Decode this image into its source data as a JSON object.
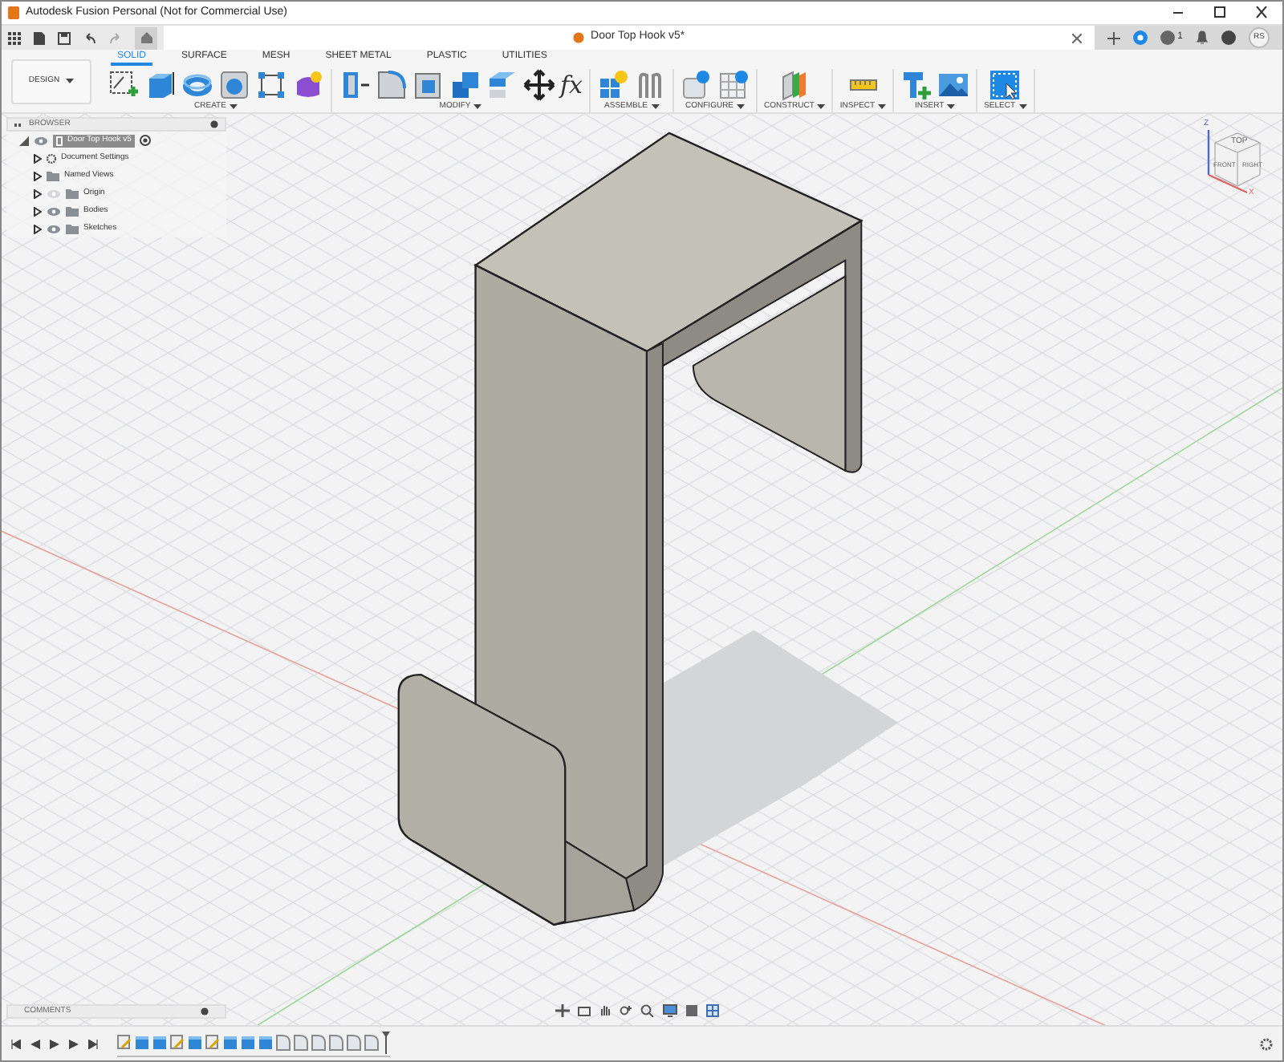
{
  "window": {
    "title": "Autodesk Fusion Personal (Not for Commercial Use)"
  },
  "document_tab": {
    "title": "Door Top Hook v5*"
  },
  "account": {
    "job_count": "1",
    "initials": "RS"
  },
  "workspace": {
    "label": "DESIGN"
  },
  "toolbar_tabs": [
    {
      "label": "SOLID",
      "selected": true
    },
    {
      "label": "SURFACE",
      "selected": false
    },
    {
      "label": "MESH",
      "selected": false
    },
    {
      "label": "SHEET METAL",
      "selected": false
    },
    {
      "label": "PLASTIC",
      "selected": false
    },
    {
      "label": "UTILITIES",
      "selected": false
    }
  ],
  "toolbar_groups": [
    {
      "label": "CREATE",
      "tools": [
        {
          "kind": "sketch"
        },
        {
          "kind": "extrude"
        },
        {
          "kind": "revolve"
        },
        {
          "kind": "hole"
        },
        {
          "kind": "pattern"
        },
        {
          "kind": "form"
        }
      ]
    },
    {
      "label": "MODIFY",
      "tools": [
        {
          "kind": "presspull"
        },
        {
          "kind": "fillet"
        },
        {
          "kind": "shell"
        },
        {
          "kind": "combine"
        },
        {
          "kind": "split"
        },
        {
          "kind": "move"
        },
        {
          "kind": "function",
          "glyph": "fx"
        }
      ]
    },
    {
      "label": "ASSEMBLE",
      "tools": [
        {
          "kind": "component"
        },
        {
          "kind": "joint"
        }
      ]
    },
    {
      "label": "CONFIGURE",
      "tools": [
        {
          "kind": "configure"
        },
        {
          "kind": "table"
        }
      ]
    },
    {
      "label": "CONSTRUCT",
      "tools": [
        {
          "kind": "plane"
        }
      ]
    },
    {
      "label": "INSPECT",
      "tools": [
        {
          "kind": "measure"
        }
      ]
    },
    {
      "label": "INSERT",
      "tools": [
        {
          "kind": "derive"
        },
        {
          "kind": "image"
        }
      ]
    },
    {
      "label": "SELECT",
      "tools": [
        {
          "kind": "select"
        }
      ]
    }
  ],
  "browser": {
    "title": "BROWSER",
    "root": {
      "label": "Door Top Hook v5",
      "visible": true
    },
    "items": [
      {
        "label": "Document Settings",
        "kind": "settings",
        "expanded": false
      },
      {
        "label": "Named Views",
        "kind": "folder",
        "expanded": false
      },
      {
        "label": "Origin",
        "kind": "folder",
        "expanded": false,
        "visible": false
      },
      {
        "label": "Bodies",
        "kind": "folder",
        "expanded": false,
        "visible": true
      },
      {
        "label": "Sketches",
        "kind": "folder",
        "expanded": false,
        "visible": true
      }
    ]
  },
  "view_cube": {
    "faces": [
      "TOP",
      "FRONT",
      "RIGHT"
    ],
    "axes": [
      "Z",
      "X"
    ]
  },
  "comments": {
    "title": "COMMENTS"
  },
  "timeline": {
    "steps": [
      {
        "kind": "sketch"
      },
      {
        "kind": "extrude"
      },
      {
        "kind": "extrude"
      },
      {
        "kind": "sketch"
      },
      {
        "kind": "extrude"
      },
      {
        "kind": "sketch"
      },
      {
        "kind": "extrude"
      },
      {
        "kind": "extrude"
      },
      {
        "kind": "extrude"
      },
      {
        "kind": "fillet"
      },
      {
        "kind": "fillet"
      },
      {
        "kind": "fillet"
      },
      {
        "kind": "fillet"
      },
      {
        "kind": "fillet"
      },
      {
        "kind": "fillet"
      }
    ]
  }
}
